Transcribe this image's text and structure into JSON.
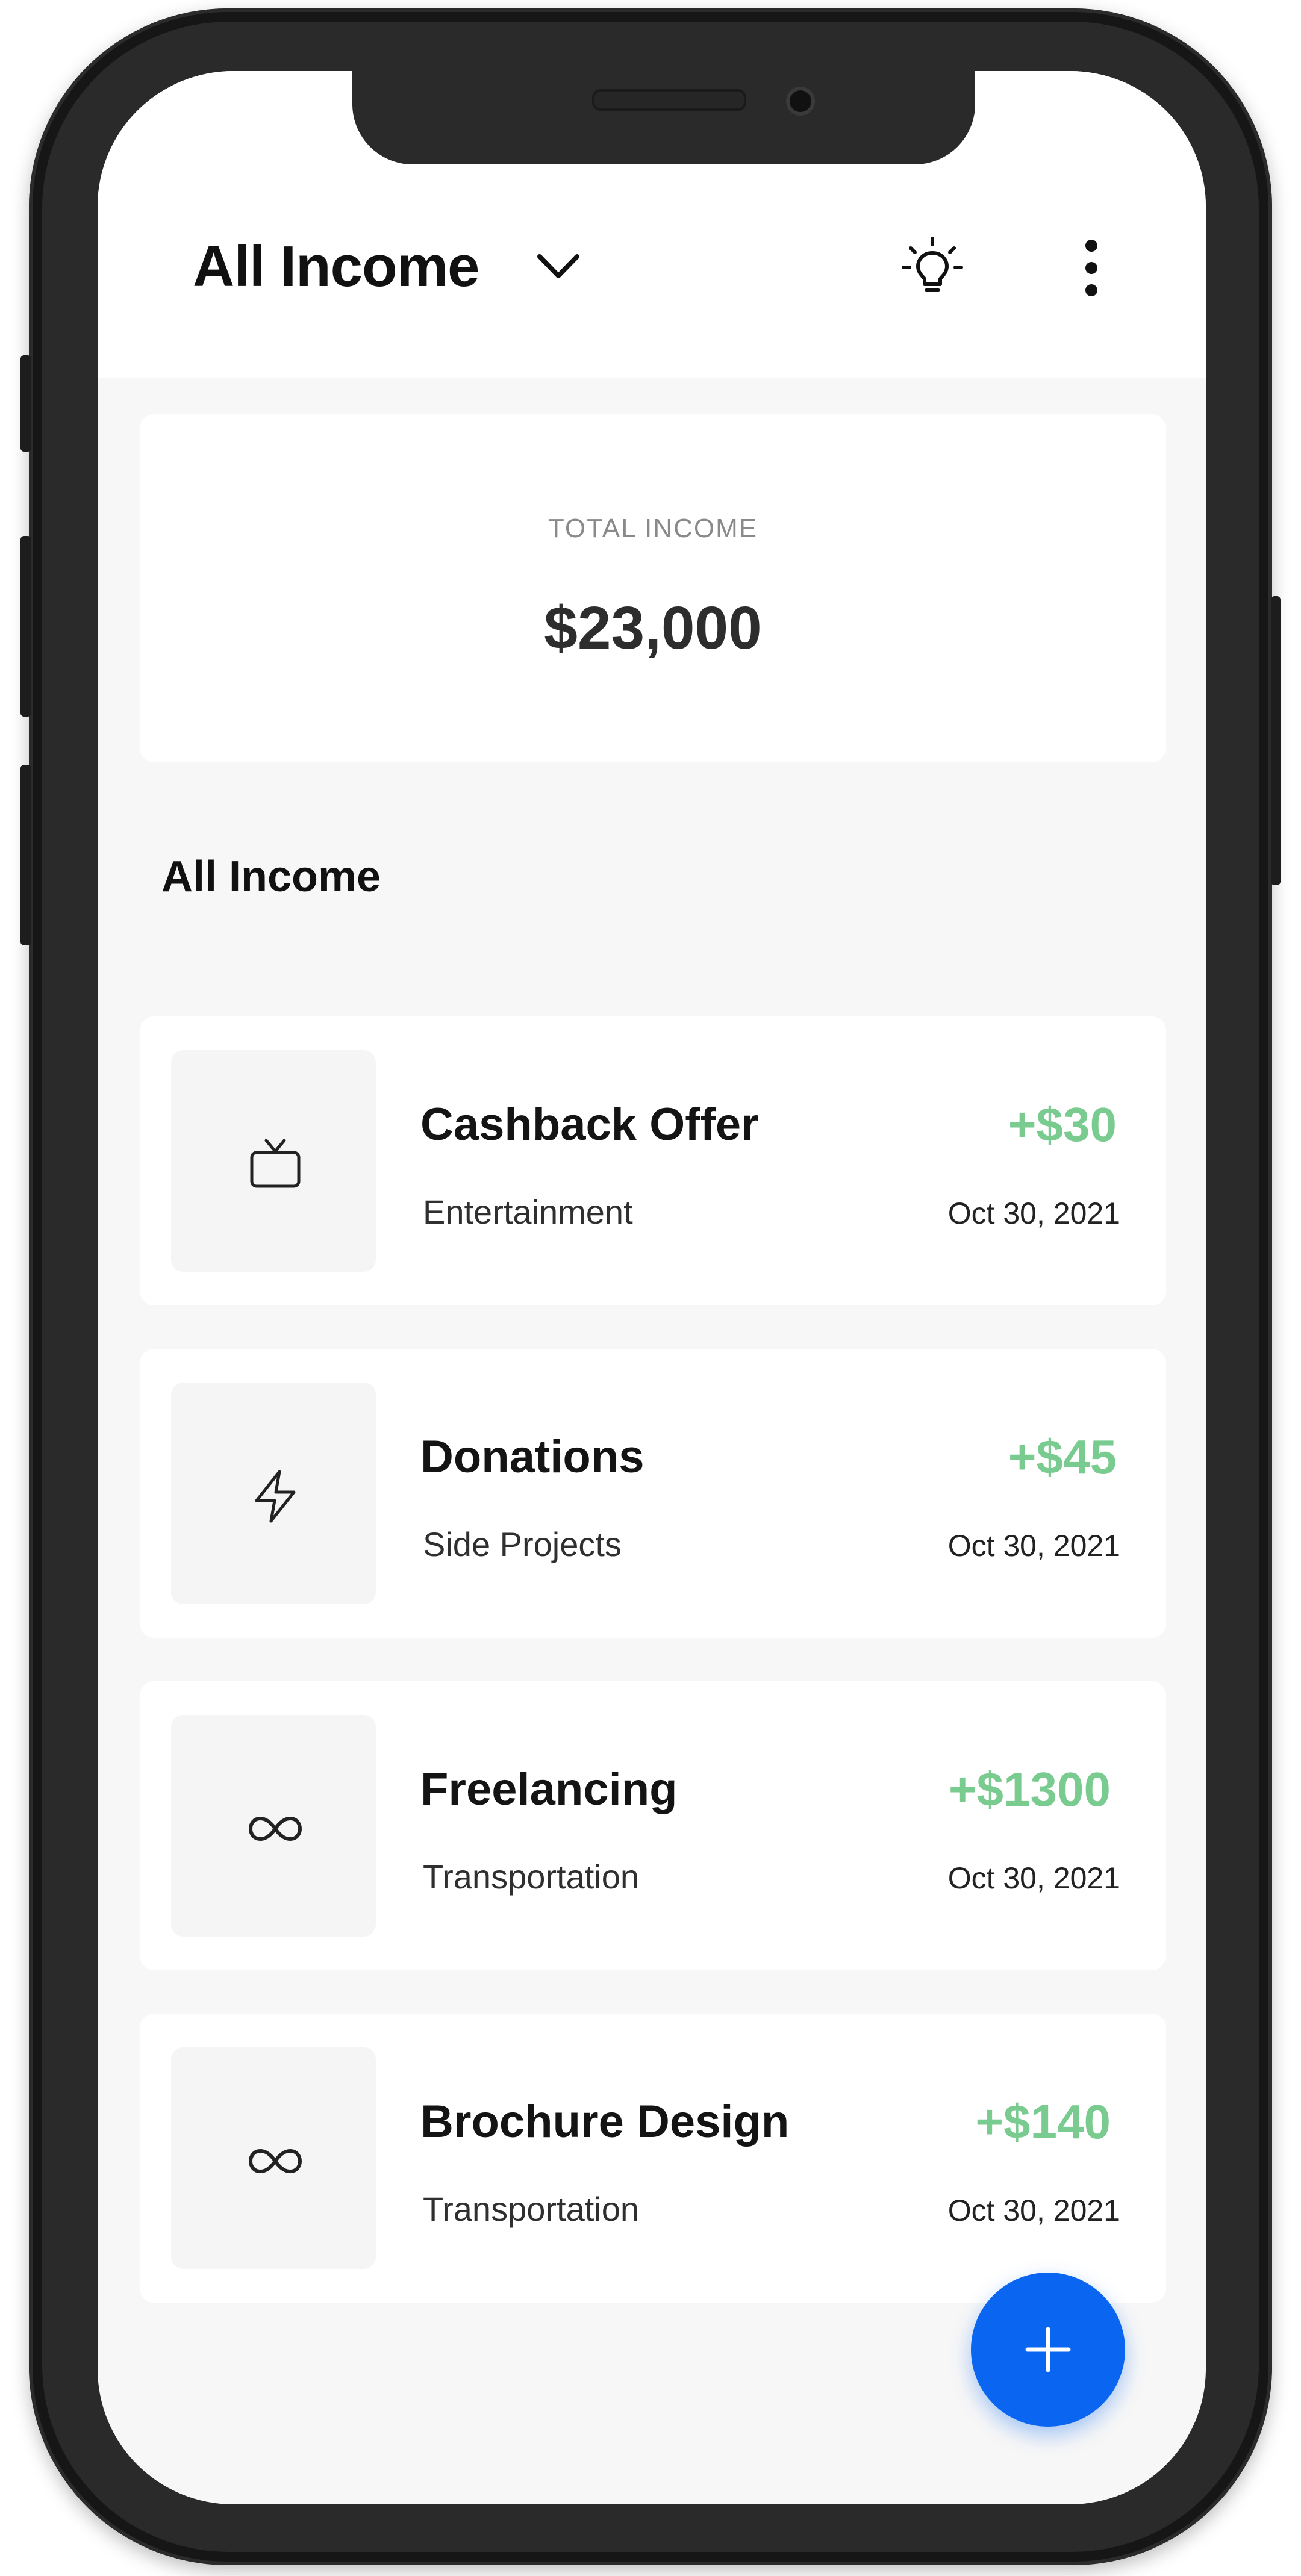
{
  "header": {
    "title": "All Income",
    "dropdown_icon": "chevron-down-icon",
    "tips_icon": "lightbulb-icon",
    "menu_icon": "more-vertical-icon"
  },
  "summary": {
    "label": "TOTAL INCOME",
    "value": "$23,000"
  },
  "list": {
    "title": "All Income",
    "items": [
      {
        "title": "Cashback Offer",
        "category": "Entertainment",
        "amount": "+$30",
        "date": "Oct 30, 2021",
        "icon": "tv-icon"
      },
      {
        "title": "Donations",
        "category": "Side Projects",
        "amount": "+$45",
        "date": "Oct 30, 2021",
        "icon": "lightning-icon"
      },
      {
        "title": "Freelancing",
        "category": "Transportation",
        "amount": "+$1300",
        "date": "Oct 30, 2021",
        "icon": "infinity-icon"
      },
      {
        "title": "Brochure Design",
        "category": "Transportation",
        "amount": "+$140",
        "date": "Oct 30, 2021",
        "icon": "infinity-icon"
      }
    ]
  },
  "fab": {
    "icon": "plus-icon"
  },
  "colors": {
    "accent": "#0a66f0",
    "income_green": "#7acb8f",
    "background": "#f7f7f7",
    "card": "#ffffff"
  }
}
